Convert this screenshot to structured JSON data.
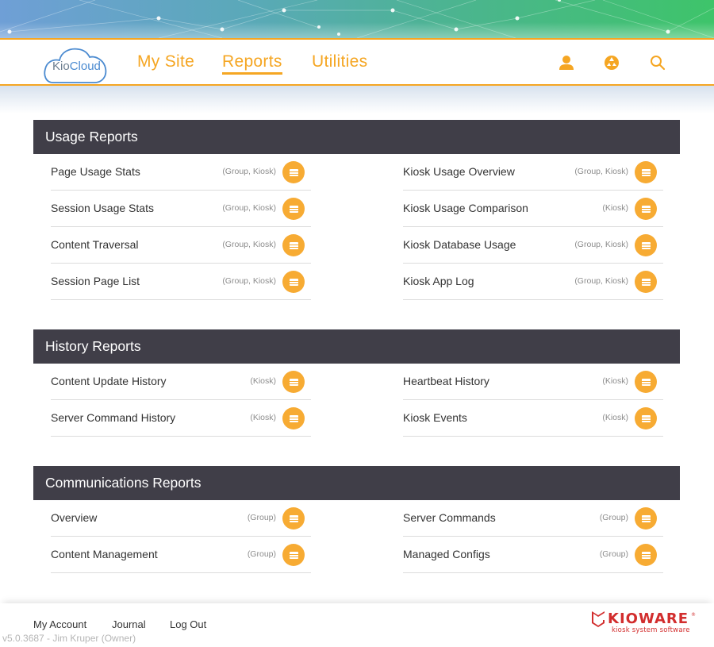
{
  "header": {
    "logo_text_kio": "Kio",
    "logo_text_cloud": "Cloud",
    "nav": [
      {
        "label": "My Site",
        "active": false
      },
      {
        "label": "Reports",
        "active": true
      },
      {
        "label": "Utilities",
        "active": false
      }
    ],
    "icons": [
      "user-icon",
      "recycle-icon",
      "search-icon"
    ],
    "accent_color": "#f5a623"
  },
  "sections": [
    {
      "title": "Usage Reports",
      "left": [
        {
          "title": "Page Usage Stats",
          "scope": "(Group, Kiosk)"
        },
        {
          "title": "Session Usage Stats",
          "scope": "(Group, Kiosk)"
        },
        {
          "title": "Content Traversal",
          "scope": "(Group, Kiosk)"
        },
        {
          "title": "Session Page List",
          "scope": "(Group, Kiosk)"
        }
      ],
      "right": [
        {
          "title": "Kiosk Usage Overview",
          "scope": "(Group, Kiosk)"
        },
        {
          "title": "Kiosk Usage Comparison",
          "scope": "(Kiosk)"
        },
        {
          "title": "Kiosk Database Usage",
          "scope": "(Group, Kiosk)"
        },
        {
          "title": "Kiosk App Log",
          "scope": "(Group, Kiosk)"
        }
      ]
    },
    {
      "title": "History Reports",
      "left": [
        {
          "title": "Content Update History",
          "scope": "(Kiosk)"
        },
        {
          "title": "Server Command History",
          "scope": "(Kiosk)"
        }
      ],
      "right": [
        {
          "title": "Heartbeat History",
          "scope": "(Kiosk)"
        },
        {
          "title": "Kiosk Events",
          "scope": "(Kiosk)"
        }
      ]
    },
    {
      "title": "Communications Reports",
      "left": [
        {
          "title": "Overview",
          "scope": "(Group)"
        },
        {
          "title": "Content Management",
          "scope": "(Group)"
        }
      ],
      "right": [
        {
          "title": "Server Commands",
          "scope": "(Group)"
        },
        {
          "title": "Managed Configs",
          "scope": "(Group)"
        }
      ]
    }
  ],
  "footer": {
    "links": [
      "My Account",
      "Journal",
      "Log Out"
    ],
    "version": "v5.0.3687 - Jim Kruper (Owner)",
    "brand": "KIOWARE",
    "brand_tagline": "kiosk system software",
    "brand_color": "#d22d2d"
  }
}
